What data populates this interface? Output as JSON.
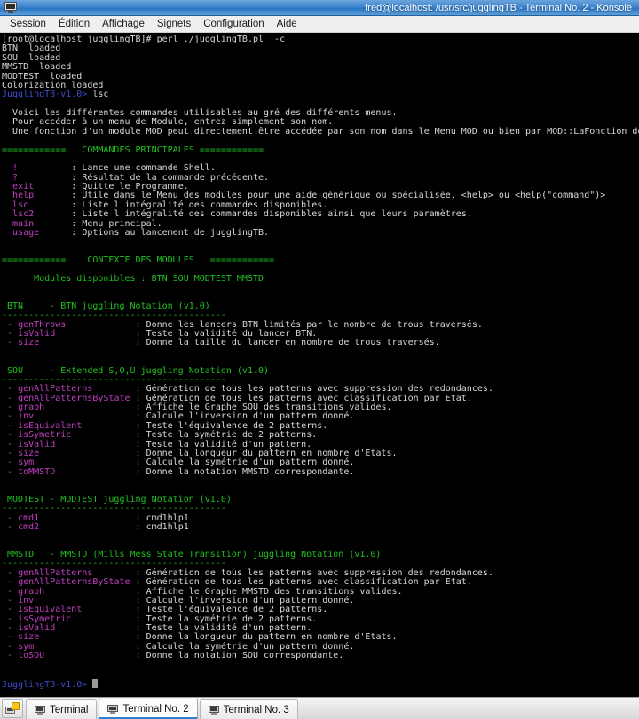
{
  "window": {
    "title": "fred@localhost: /usr/src/jugglingTB - Terminal No. 2 - Konsole",
    "icon": "terminal-icon",
    "titlebar_color": "#3f85cd"
  },
  "menubar": {
    "items": [
      {
        "label": "Session"
      },
      {
        "label": "Édition"
      },
      {
        "label": "Affichage"
      },
      {
        "label": "Signets"
      },
      {
        "label": "Configuration"
      },
      {
        "label": "Aide"
      }
    ]
  },
  "colors": {
    "background": "#000000",
    "foreground": "#d8d8d8",
    "green": "#22c022",
    "magenta": "#c040c0",
    "blue": "#3b4ccc"
  },
  "terminal": {
    "shell_prompt": "[root@localhost jugglingTB]#",
    "command": "perl ./jugglingTB.pl  -c",
    "boot_lines": [
      "BTN  loaded",
      "SOU  loaded",
      "MMSTD  loaded",
      "MODTEST  loaded",
      "Colorization loaded"
    ],
    "app_prompt": "JugglingTB-v1.0>",
    "entered_command": "lsc",
    "intro": [
      "  Voici les différentes commandes utilisables au gré des différents menus.",
      "  Pour accéder à un menu de Module, entrez simplement son nom.",
      "  Une fonction d'un module MOD peut directement être accédée par son nom dans le Menu MOD ou bien par MOD::LaFonction depuis n'importe quel Menu."
    ],
    "section_main": {
      "header_left": "============",
      "header_title": "COMMANDES PRINCIPALES",
      "header_right": "============",
      "commands": [
        {
          "name": "!",
          "desc": "Lance une commande Shell."
        },
        {
          "name": "?",
          "desc": "Résultat de la commande précédente."
        },
        {
          "name": "exit",
          "desc": "Quitte le Programme."
        },
        {
          "name": "help",
          "desc": "Utile dans le Menu des modules pour une aide générique ou spécialisée. <help> ou <help(\"command\")>"
        },
        {
          "name": "lsc",
          "desc": "Liste l'intégralité des commandes disponibles."
        },
        {
          "name": "lsc2",
          "desc": "Liste l'intégralité des commandes disponibles ainsi que leurs paramètres."
        },
        {
          "name": "main",
          "desc": "Menu principal."
        },
        {
          "name": "usage",
          "desc": "Options au lancement de jugglingTB."
        }
      ]
    },
    "section_modules": {
      "header_left": "============",
      "header_title": "CONTEXTE DES MODULES",
      "header_right": "============",
      "available_label": "Modules disponibles :",
      "available_modules": "BTN SOU MODTEST MMSTD",
      "modules": [
        {
          "name": "BTN",
          "title": "- BTN juggling Notation (v1.0)",
          "rule": "------------------------------------------",
          "functions": [
            {
              "name": "genThrows",
              "desc": "Donne les lancers BTN limités par le nombre de trous traversés."
            },
            {
              "name": "isValid",
              "desc": "Teste la validité du lancer BTN."
            },
            {
              "name": "size",
              "desc": "Donne la taille du lancer en nombre de trous traversés."
            }
          ]
        },
        {
          "name": "SOU",
          "title": "- Extended S,O,U juggling Notation (v1.0)",
          "rule": "------------------------------------------",
          "functions": [
            {
              "name": "genAllPatterns",
              "desc": "Génération de tous les patterns avec suppression des redondances."
            },
            {
              "name": "genAllPatternsByState",
              "desc": "Génération de tous les patterns avec classification par Etat."
            },
            {
              "name": "graph",
              "desc": "Affiche le Graphe SOU des transitions valides."
            },
            {
              "name": "inv",
              "desc": "Calcule l'inversion d'un pattern donné."
            },
            {
              "name": "isEquivalent",
              "desc": "Teste l'équivalence de 2 patterns."
            },
            {
              "name": "isSymetric",
              "desc": "Teste la symétrie de 2 patterns."
            },
            {
              "name": "isValid",
              "desc": "Teste la validité d'un pattern."
            },
            {
              "name": "size",
              "desc": "Donne la longueur du pattern en nombre d'Etats."
            },
            {
              "name": "sym",
              "desc": "Calcule la symétrie d'un pattern donné."
            },
            {
              "name": "toMMSTD",
              "desc": "Donne la notation MMSTD correspondante."
            }
          ]
        },
        {
          "name": "MODTEST",
          "title": "- MODTEST juggling Notation (v1.0)",
          "rule": "------------------------------------------",
          "functions": [
            {
              "name": "cmd1",
              "desc": "cmd1hlp1"
            },
            {
              "name": "cmd2",
              "desc": "cmd1hlp1"
            }
          ]
        },
        {
          "name": "MMSTD",
          "title": "- MMSTD (Mills Mess State Transition) juggling Notation (v1.0)",
          "rule": "------------------------------------------",
          "functions": [
            {
              "name": "genAllPatterns",
              "desc": "Génération de tous les patterns avec suppression des redondances."
            },
            {
              "name": "genAllPatternsByState",
              "desc": "Génération de tous les patterns avec classification par Etat."
            },
            {
              "name": "graph",
              "desc": "Affiche le Graphe MMSTD des transitions valides."
            },
            {
              "name": "inv",
              "desc": "Calcule l'inversion d'un pattern donné."
            },
            {
              "name": "isEquivalent",
              "desc": "Teste l'équivalence de 2 patterns."
            },
            {
              "name": "isSymetric",
              "desc": "Teste la symétrie de 2 patterns."
            },
            {
              "name": "isValid",
              "desc": "Teste la validité d'un pattern."
            },
            {
              "name": "size",
              "desc": "Donne la longueur du pattern en nombre d'Etats."
            },
            {
              "name": "sym",
              "desc": "Calcule la symétrie d'un pattern donné."
            },
            {
              "name": "toSOU",
              "desc": "Donne la notation SOU correspondante."
            }
          ]
        }
      ]
    }
  },
  "taskbar": {
    "new_tab_icon": "new-terminal-icon",
    "tabs": [
      {
        "label": "Terminal",
        "icon": "terminal-icon",
        "active": false
      },
      {
        "label": "Terminal No. 2",
        "icon": "terminal-icon",
        "active": true
      },
      {
        "label": "Terminal No. 3",
        "icon": "terminal-icon",
        "active": false
      }
    ]
  }
}
